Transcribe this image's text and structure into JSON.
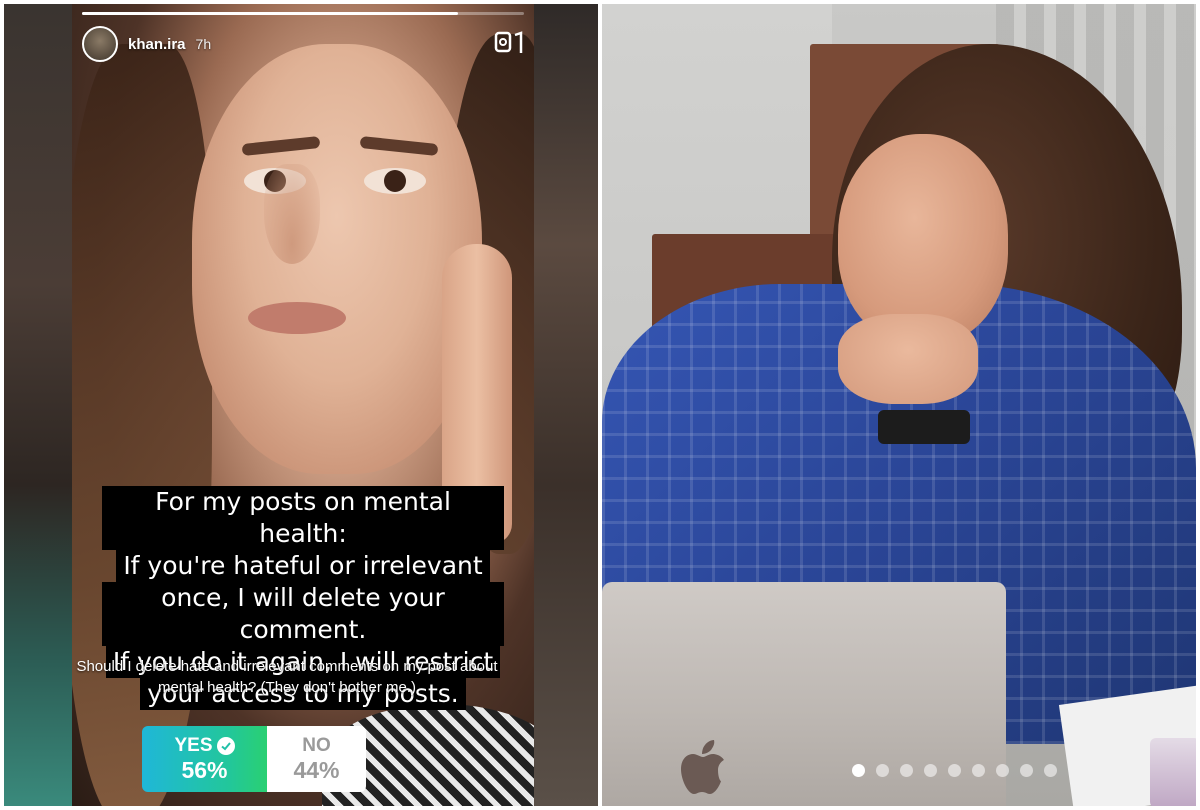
{
  "story": {
    "username": "khan.ira",
    "timestamp": "7h",
    "progress": 0.85,
    "caption_lines": [
      "For my posts on mental health:",
      "If you're hateful or irrelevant",
      "once, I will delete your comment.",
      "If you do it again, I will restrict",
      "your access to my posts."
    ],
    "poll": {
      "question": "Should I delete hate and irrelevant comments on my post about mental health? (They don't bother me.)",
      "options": [
        {
          "label": "YES",
          "percent": "56%",
          "selected": true
        },
        {
          "label": "NO",
          "percent": "44%",
          "selected": false
        }
      ]
    },
    "icons": [
      "avatar",
      "phone-time-icon",
      "checkmark-icon"
    ]
  },
  "photo": {
    "carousel_total": 9,
    "carousel_active_index": 0,
    "icons": [
      "apple-logo-icon"
    ]
  },
  "colors": {
    "poll_yes_gradient_start": "#1fb7d8",
    "poll_yes_gradient_end": "#2ad072",
    "poll_no_bg": "#ffffff",
    "caption_bg": "#000000",
    "caption_text": "#ffffff"
  }
}
